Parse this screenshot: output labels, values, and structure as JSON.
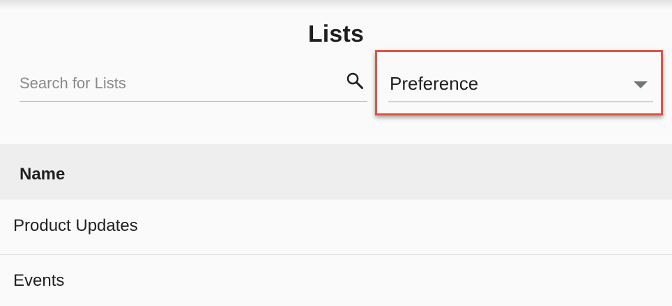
{
  "page": {
    "title": "Lists"
  },
  "search": {
    "placeholder": "Search for Lists",
    "value": "",
    "icon": "search-icon"
  },
  "filter": {
    "selected": "Preference",
    "icon": "chevron-down-icon",
    "highlight_color": "#e0533e"
  },
  "table": {
    "columns": [
      "Name"
    ],
    "rows": [
      {
        "name": "Product Updates"
      },
      {
        "name": "Events"
      }
    ]
  }
}
